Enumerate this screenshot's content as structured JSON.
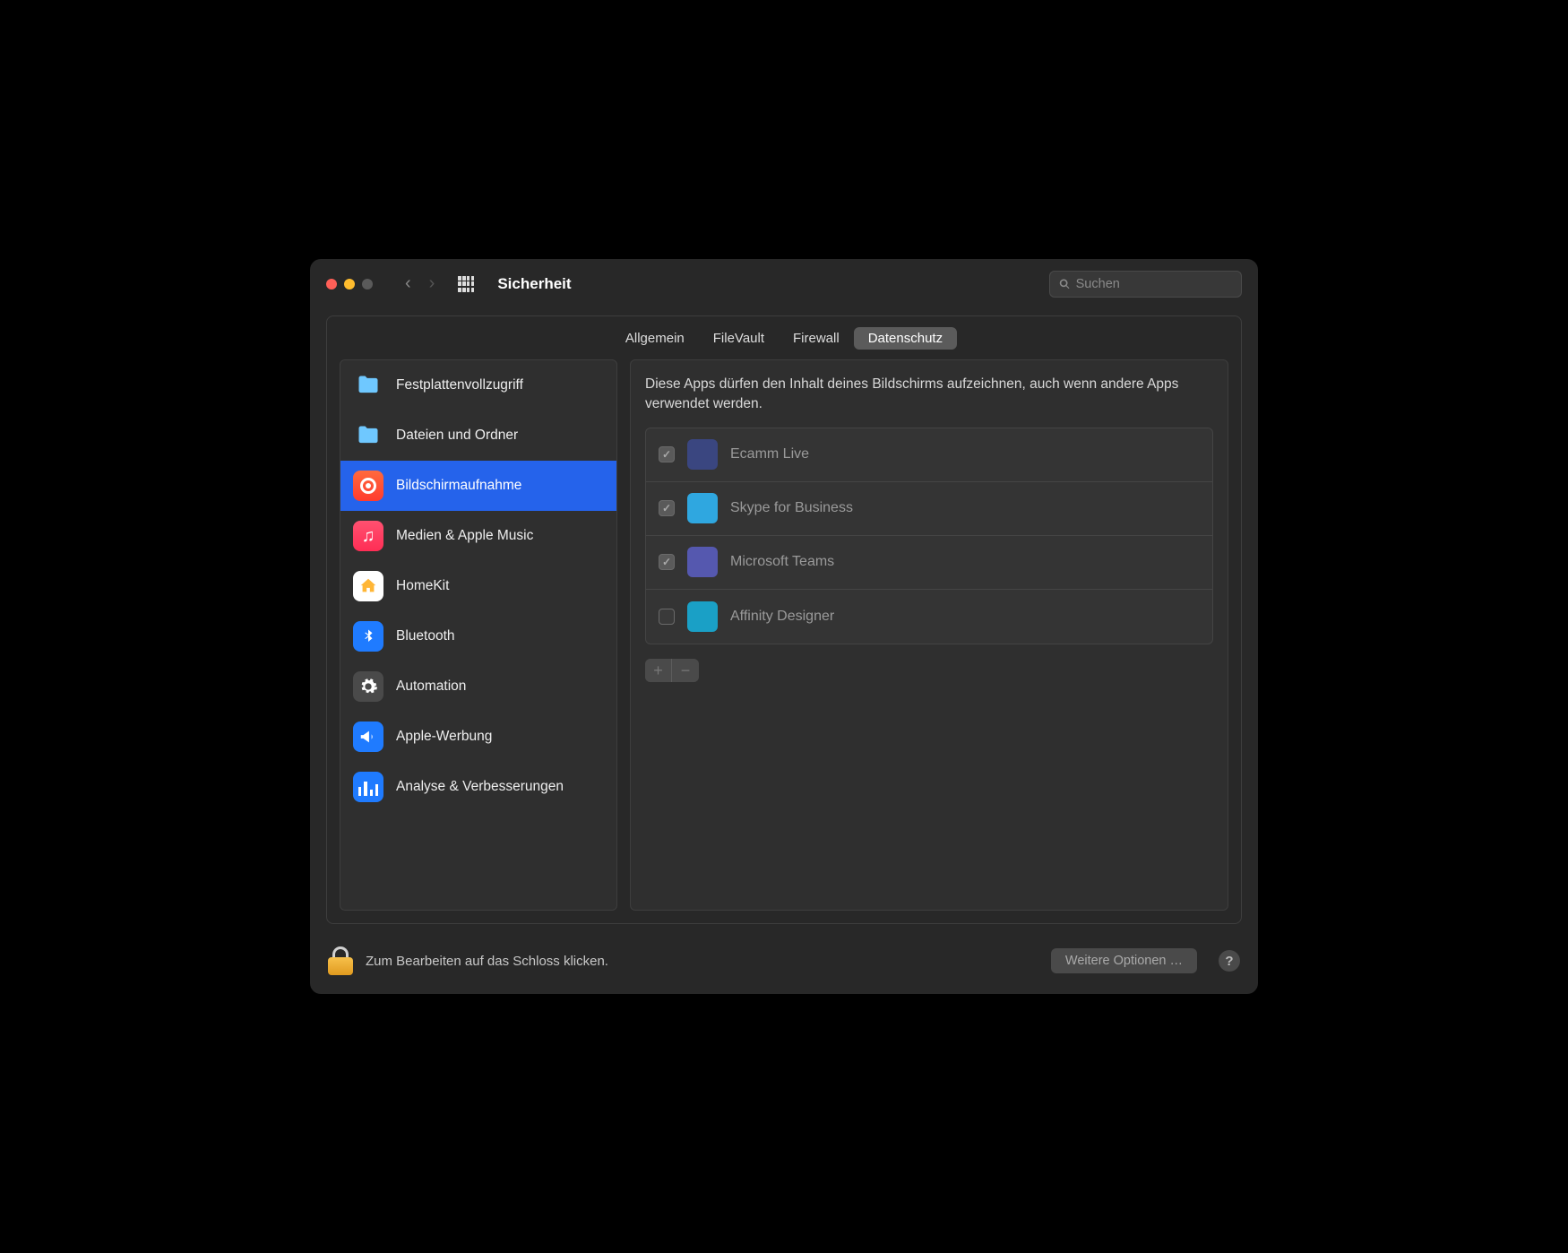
{
  "window": {
    "title": "Sicherheit"
  },
  "search": {
    "placeholder": "Suchen"
  },
  "tabs": [
    {
      "label": "Allgemein",
      "active": false
    },
    {
      "label": "FileVault",
      "active": false
    },
    {
      "label": "Firewall",
      "active": false
    },
    {
      "label": "Datenschutz",
      "active": true
    }
  ],
  "sidebar": {
    "items": [
      {
        "label": "Festplattenvollzugriff",
        "icon": "folder-icon",
        "color": "#6fc8ff",
        "selected": false
      },
      {
        "label": "Dateien und Ordner",
        "icon": "folder-icon",
        "color": "#6fc8ff",
        "selected": false
      },
      {
        "label": "Bildschirmaufnahme",
        "icon": "record-icon",
        "color": "#ff4d3a",
        "selected": true
      },
      {
        "label": "Medien & Apple Music",
        "icon": "music-icon",
        "color": "#ff3757",
        "selected": false
      },
      {
        "label": "HomeKit",
        "icon": "home-icon",
        "color": "#ffffff",
        "selected": false
      },
      {
        "label": "Bluetooth",
        "icon": "bluetooth-icon",
        "color": "#1f7bff",
        "selected": false
      },
      {
        "label": "Automation",
        "icon": "gear-icon",
        "color": "#4a4a4a",
        "selected": false
      },
      {
        "label": "Apple-Werbung",
        "icon": "megaphone-icon",
        "color": "#1f7bff",
        "selected": false
      },
      {
        "label": "Analyse & Verbesserungen",
        "icon": "bars-icon",
        "color": "#1f7bff",
        "selected": false
      }
    ]
  },
  "content": {
    "description": "Diese Apps dürfen den Inhalt deines Bildschirms aufzeichnen, auch wenn andere Apps verwendet werden.",
    "apps": [
      {
        "name": "Ecamm Live",
        "checked": true,
        "icon_color": "#3a4680"
      },
      {
        "name": "Skype for Business",
        "checked": true,
        "icon_color": "#2fa7e0"
      },
      {
        "name": "Microsoft Teams",
        "checked": true,
        "icon_color": "#5558af"
      },
      {
        "name": "Affinity Designer",
        "checked": false,
        "icon_color": "#1aa0c6"
      }
    ]
  },
  "footer": {
    "lock_text": "Zum Bearbeiten auf das Schloss klicken.",
    "more_button": "Weitere Optionen …",
    "help": "?"
  }
}
